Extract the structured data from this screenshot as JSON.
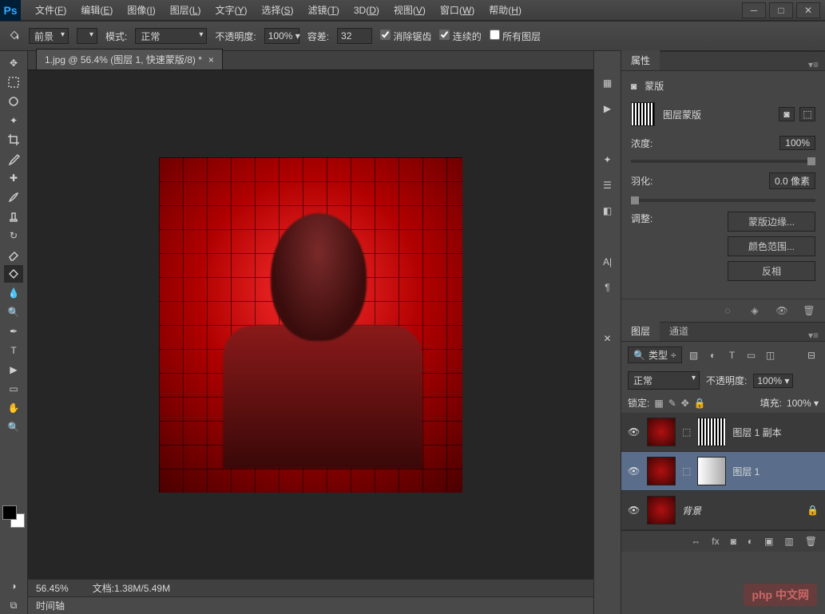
{
  "app": {
    "logo": "Ps"
  },
  "menu": {
    "file": {
      "label": "文件",
      "key": "F"
    },
    "edit": {
      "label": "编辑",
      "key": "E"
    },
    "image": {
      "label": "图像",
      "key": "I"
    },
    "layer": {
      "label": "图层",
      "key": "L"
    },
    "type": {
      "label": "文字",
      "key": "Y"
    },
    "select": {
      "label": "选择",
      "key": "S"
    },
    "filter": {
      "label": "滤镜",
      "key": "T"
    },
    "3d": {
      "label": "3D",
      "key": "D"
    },
    "view": {
      "label": "视图",
      "key": "V"
    },
    "window": {
      "label": "窗口",
      "key": "W"
    },
    "help": {
      "label": "帮助",
      "key": "H"
    }
  },
  "options": {
    "fill_source": "前景",
    "mode_label": "模式:",
    "mode_value": "正常",
    "opacity_label": "不透明度:",
    "opacity_value": "100%",
    "tolerance_label": "容差:",
    "tolerance_value": "32",
    "antialias": "消除锯齿",
    "contiguous": "连续的",
    "all_layers": "所有图层"
  },
  "doc": {
    "tab_title": "1.jpg @ 56.4% (图层 1, 快速蒙版/8) *",
    "zoom": "56.45%",
    "docinfo": "文档:1.38M/5.49M",
    "timeline": "时间轴"
  },
  "properties": {
    "panel_title": "属性",
    "type_label": "蒙版",
    "mask_label": "图层蒙版",
    "density_label": "浓度:",
    "density_value": "100%",
    "feather_label": "羽化:",
    "feather_value": "0.0 像素",
    "adjust_label": "调整:",
    "btn_edge": "蒙版边缘...",
    "btn_range": "颜色范围...",
    "btn_invert": "反相"
  },
  "layers": {
    "tab_layers": "图层",
    "tab_channels": "通道",
    "filter_kind": "类型",
    "blend_mode": "正常",
    "opacity_label": "不透明度:",
    "opacity_value": "100%",
    "lock_label": "锁定:",
    "fill_label": "填充:",
    "fill_value": "100%",
    "items": [
      {
        "name": "图层 1 副本"
      },
      {
        "name": "图层 1"
      },
      {
        "name": "背景"
      }
    ]
  },
  "watermark": "php 中文网"
}
